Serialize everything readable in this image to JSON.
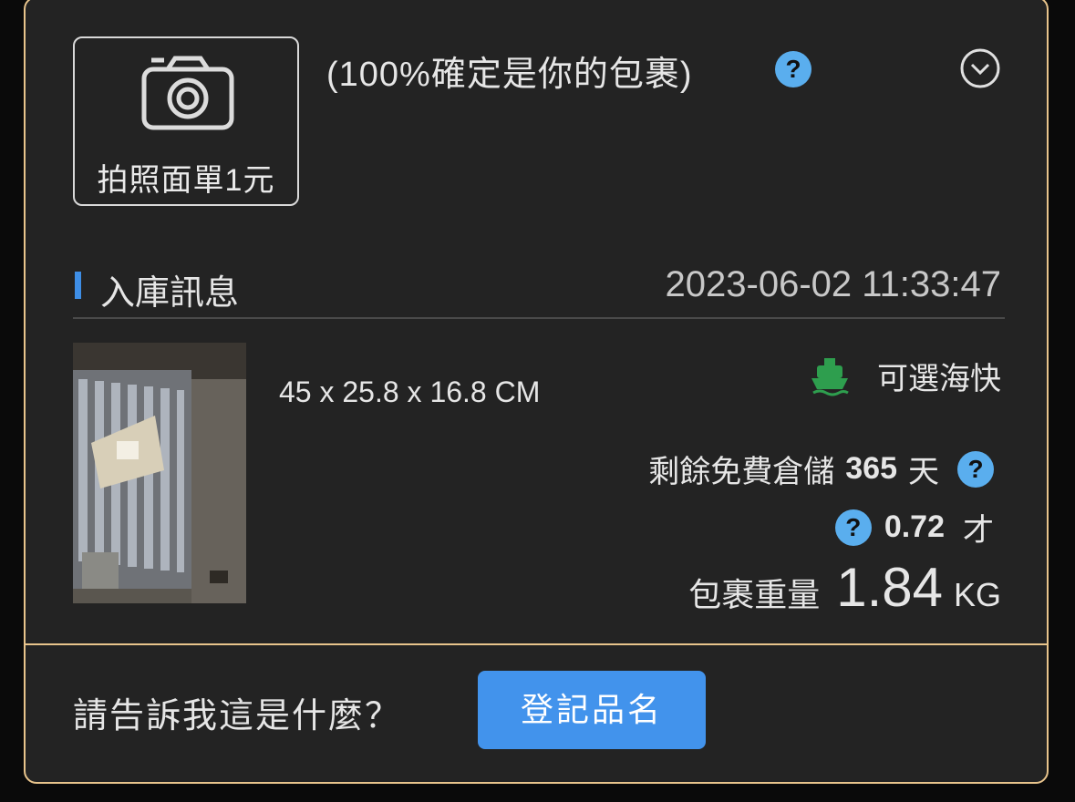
{
  "photo_button": {
    "label": "拍照面單1元",
    "icon": "camera-icon"
  },
  "confirm_text": "(100%確定是你的包裹)",
  "help_glyph": "?",
  "section": {
    "title": "入庫訊息",
    "timestamp": "2023-06-02 11:33:47"
  },
  "package": {
    "dimensions": "45 x 25.8 x 16.8 CM",
    "shipping_option": "可選海快",
    "shipping_icon": "ship-icon",
    "storage_label": "剩餘免費倉儲",
    "storage_days": "365",
    "storage_unit": "天",
    "volume": "0.72",
    "volume_unit": "才",
    "weight_label": "包裹重量",
    "weight": "1.84",
    "weight_unit": "KG"
  },
  "footer": {
    "question": "請告訴我這是什麼？",
    "register_label": "登記品名"
  },
  "colors": {
    "accent_blue": "#4293ec",
    "help_blue": "#5aaeee",
    "border_gold": "#e8c48c",
    "ship_green": "#2e9e4e"
  }
}
